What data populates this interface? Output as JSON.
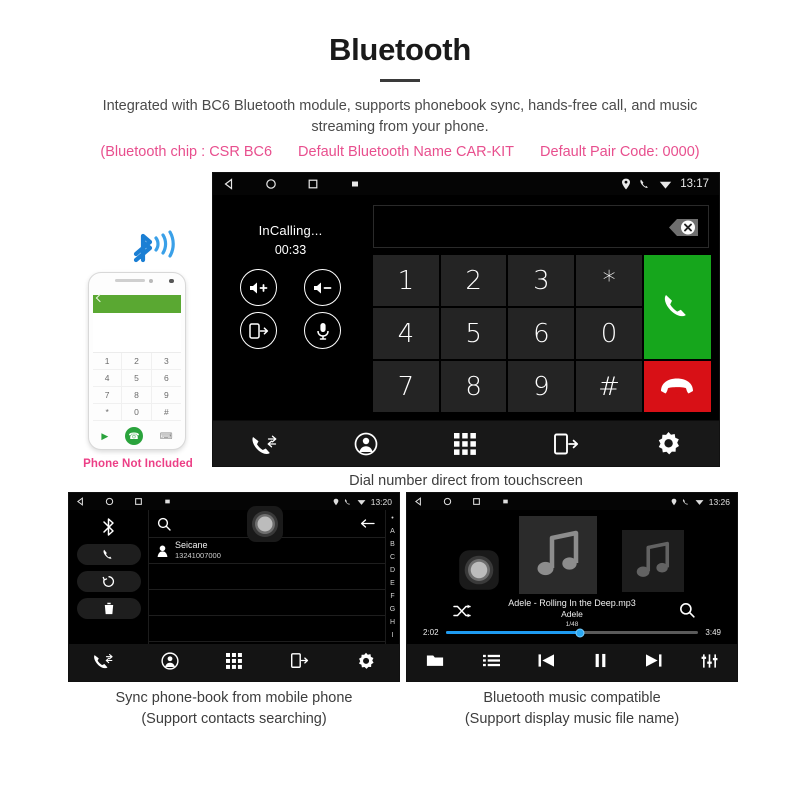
{
  "header": {
    "title": "Bluetooth",
    "subtitle": "Integrated with BC6 Bluetooth module, supports phonebook sync, hands-free call, and music streaming from your phone.",
    "specs": [
      "(Bluetooth chip : CSR BC6",
      "Default Bluetooth Name CAR-KIT",
      "Default Pair Code: 0000)"
    ],
    "accent_color": "#e84f8e"
  },
  "phone_illustration": {
    "caption": "Phone Not Included",
    "caption_color": "#ec3f86",
    "keys": [
      "1",
      "2",
      "3",
      "4",
      "5",
      "6",
      "7",
      "8",
      "9",
      "*",
      "0",
      "#"
    ]
  },
  "dialer": {
    "status_bar": {
      "time": "13:17",
      "icons": [
        "back-icon",
        "home-icon",
        "recents-icon",
        "screenshot-icon",
        "location-icon",
        "phone-icon",
        "wifi-icon"
      ]
    },
    "input_value": "",
    "delete_icon": "backspace-icon",
    "call_status": "InCalling...",
    "call_timer": "00:33",
    "call_controls": [
      {
        "name": "volume-up",
        "label": "Volume Up"
      },
      {
        "name": "volume-down",
        "label": "Volume Down"
      },
      {
        "name": "transfer-to-phone",
        "label": "Transfer To Phone"
      },
      {
        "name": "mute-microphone",
        "label": "Mute"
      }
    ],
    "keypad": [
      "1",
      "2",
      "3",
      "*",
      "4",
      "5",
      "6",
      "0",
      "7",
      "8",
      "9",
      "#"
    ],
    "call_button": "answer-call",
    "end_button": "end-call",
    "nav_items": [
      "call-history",
      "contacts",
      "dialpad",
      "phone-sync",
      "settings"
    ],
    "caption": "Dial number direct from touchscreen"
  },
  "phonebook": {
    "status_bar": {
      "time": "13:20"
    },
    "side_actions": [
      "bluetooth-icon",
      "call-icon",
      "sync-icon",
      "delete-icon"
    ],
    "search_placeholder": "",
    "contact": {
      "name": "Seicane",
      "number": "13241007000"
    },
    "index": [
      "•",
      "A",
      "B",
      "C",
      "D",
      "E",
      "F",
      "G",
      "H",
      "I"
    ],
    "nav_items": [
      "call-history",
      "contacts",
      "dialpad",
      "phone-sync",
      "settings"
    ],
    "caption_line1": "Sync phone-book from mobile phone",
    "caption_line2": "(Support contacts searching)"
  },
  "music": {
    "status_bar": {
      "time": "13:26"
    },
    "track_title": "Adele - Rolling In the Deep.mp3",
    "artist": "Adele",
    "track_index": "1/48",
    "elapsed": "2:02",
    "duration": "3:49",
    "progress_percent": 53,
    "progress_color": "#1e9bf0",
    "controls": [
      "folder",
      "playlist",
      "previous",
      "pause",
      "next",
      "equalizer"
    ],
    "caption_line1": "Bluetooth music compatible",
    "caption_line2": "(Support display music file name)"
  }
}
